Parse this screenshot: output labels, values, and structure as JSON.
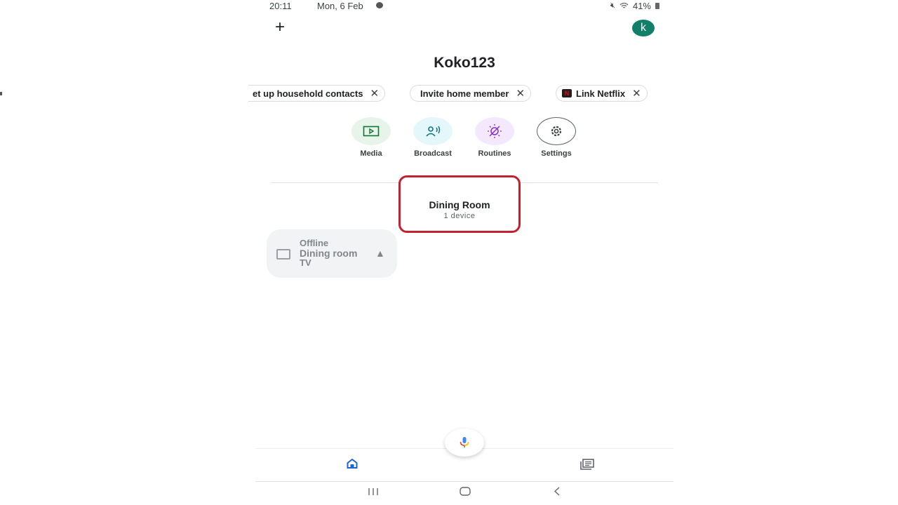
{
  "status_bar": {
    "time": "20:11",
    "date": "Mon, 6 Feb",
    "battery": "41%",
    "icons": [
      "mute-icon",
      "wifi-icon",
      "battery-icon"
    ]
  },
  "header": {
    "add_icon": "+",
    "avatar_letter": "k",
    "avatar_color": "#128069"
  },
  "home": {
    "title": "Koko123"
  },
  "chips": [
    {
      "label": "Set up household contacts",
      "visible_label": "et up household contacts",
      "close": "✕"
    },
    {
      "label": "Invite home member",
      "close": "✕"
    },
    {
      "label": "Link Netflix",
      "close": "✕",
      "logo": "N"
    }
  ],
  "actions": [
    {
      "label": "Media",
      "icon": "media-icon",
      "bg": "#e6f4ea"
    },
    {
      "label": "Broadcast",
      "icon": "broadcast-icon",
      "bg": "#e4f7fb"
    },
    {
      "label": "Routines",
      "icon": "routines-icon",
      "bg": "#f3e8fd"
    },
    {
      "label": "Settings",
      "icon": "settings-icon",
      "bg": "#ffffff"
    }
  ],
  "room": {
    "name": "Dining Room",
    "device_count": "1 device",
    "highlight_color": "#c5202f"
  },
  "device": {
    "status": "Offline",
    "name_line1": "Dining room",
    "name_line2": "TV"
  },
  "bottom_nav": {
    "items": [
      "home-icon",
      "feed-icon"
    ],
    "active": "home",
    "accent": "#1967d2"
  }
}
